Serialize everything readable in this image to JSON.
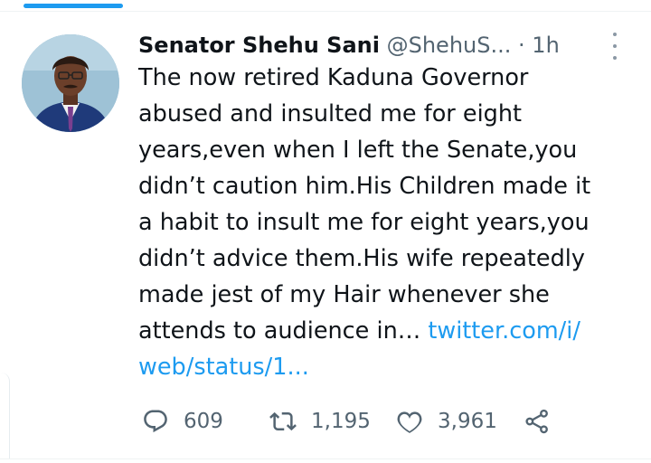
{
  "tweet": {
    "author": {
      "display_name": "Senator Shehu Sani",
      "handle": "@ShehuS...",
      "separator": "·",
      "time_ago": "1h"
    },
    "text_before_link": "The now retired Kaduna Governor\nabused and insulted me for eight\nyears,even when I left the Senate,you\ndidn’t caution him.His Children made it\na habit to insult me for eight years,you\ndidn’t advice them.His wife repeatedly\nmade jest of my Hair whenever she\nattends to audience in… ",
    "link_text": "twitter.com/i/\nweb/status/1...",
    "actions": {
      "replies": "609",
      "retweets": "1,195",
      "likes": "3,961"
    }
  },
  "icons": {
    "reply": "speech-bubble-icon",
    "retweet": "retweet-arrows-icon",
    "like": "heart-icon",
    "share": "share-nodes-icon",
    "more": "vertical-dots-icon"
  },
  "colors": {
    "accent": "#1d9bf0",
    "text": "#0f1419",
    "secondary": "#536471"
  }
}
